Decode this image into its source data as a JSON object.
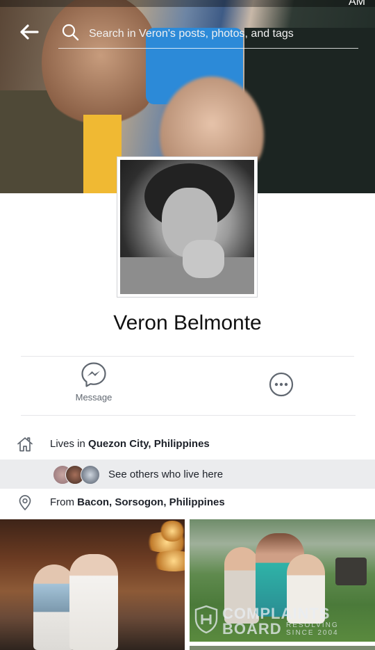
{
  "status_bar": {
    "time": "AM"
  },
  "search": {
    "placeholder": "Search in Veron's posts, photos, and tags"
  },
  "profile": {
    "name": "Veron Belmonte"
  },
  "actions": {
    "message_label": "Message"
  },
  "about": {
    "lives_prefix": "Lives in",
    "lives_place": "Quezon City, Philippines",
    "see_others": "See others who live here",
    "from_prefix": "From",
    "from_place": "Bacon, Sorsogon, Philippines"
  },
  "watermark": {
    "line1": "COMPLAINTS",
    "line2": "BOARD",
    "sub1": "RESOLVING",
    "sub2": "SINCE 2004"
  },
  "colors": {
    "accent": "#3b5998",
    "icon_gray": "#606770",
    "row_highlight": "#ebecee"
  },
  "icons": [
    "back-arrow-icon",
    "search-icon",
    "messenger-icon",
    "more-options-icon",
    "home-icon",
    "location-pin-icon",
    "shield-logo-icon"
  ]
}
